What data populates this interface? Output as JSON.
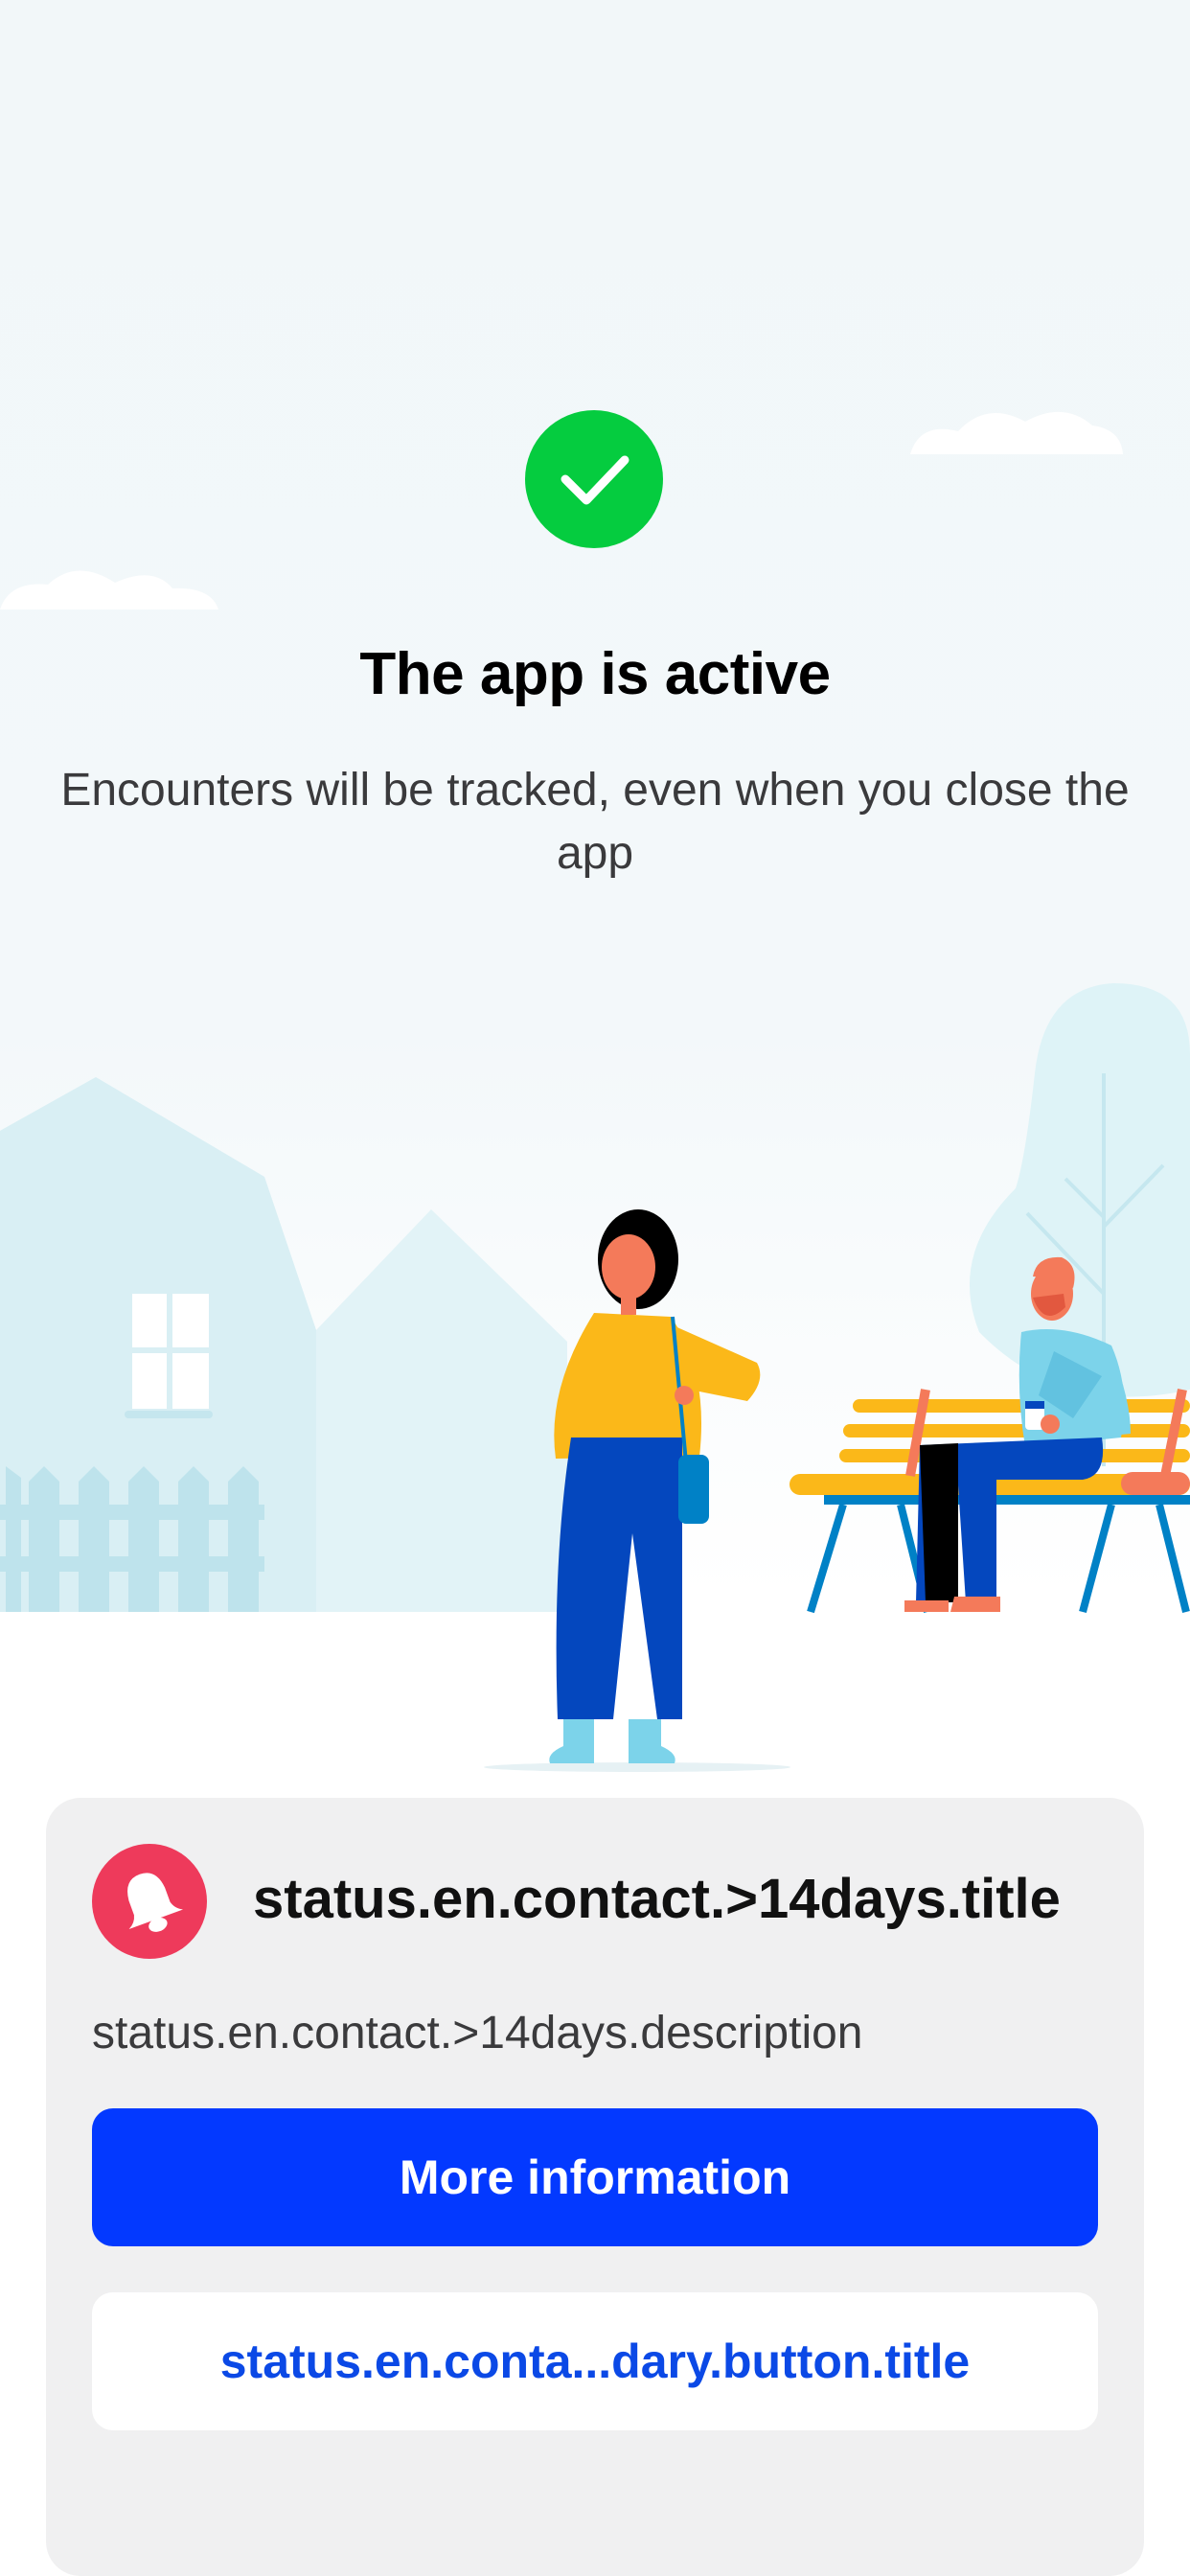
{
  "status": {
    "icon": "checkmark-icon",
    "title": "The app is active",
    "subtitle": "Encounters will be tracked, even when you close the app"
  },
  "illustration": {
    "icon": "park-scene-illustration"
  },
  "card": {
    "icon": "bell-icon",
    "title": "status.en.contact.>14days.title",
    "description": "status.en.contact.>14days.description",
    "primary_button": "More information",
    "secondary_button": "status.en.conta...dary.button.title"
  },
  "colors": {
    "success": "#05cc3f",
    "alert": "#ee3a5b",
    "primary": "#0339ff",
    "link": "#0b49e6"
  }
}
